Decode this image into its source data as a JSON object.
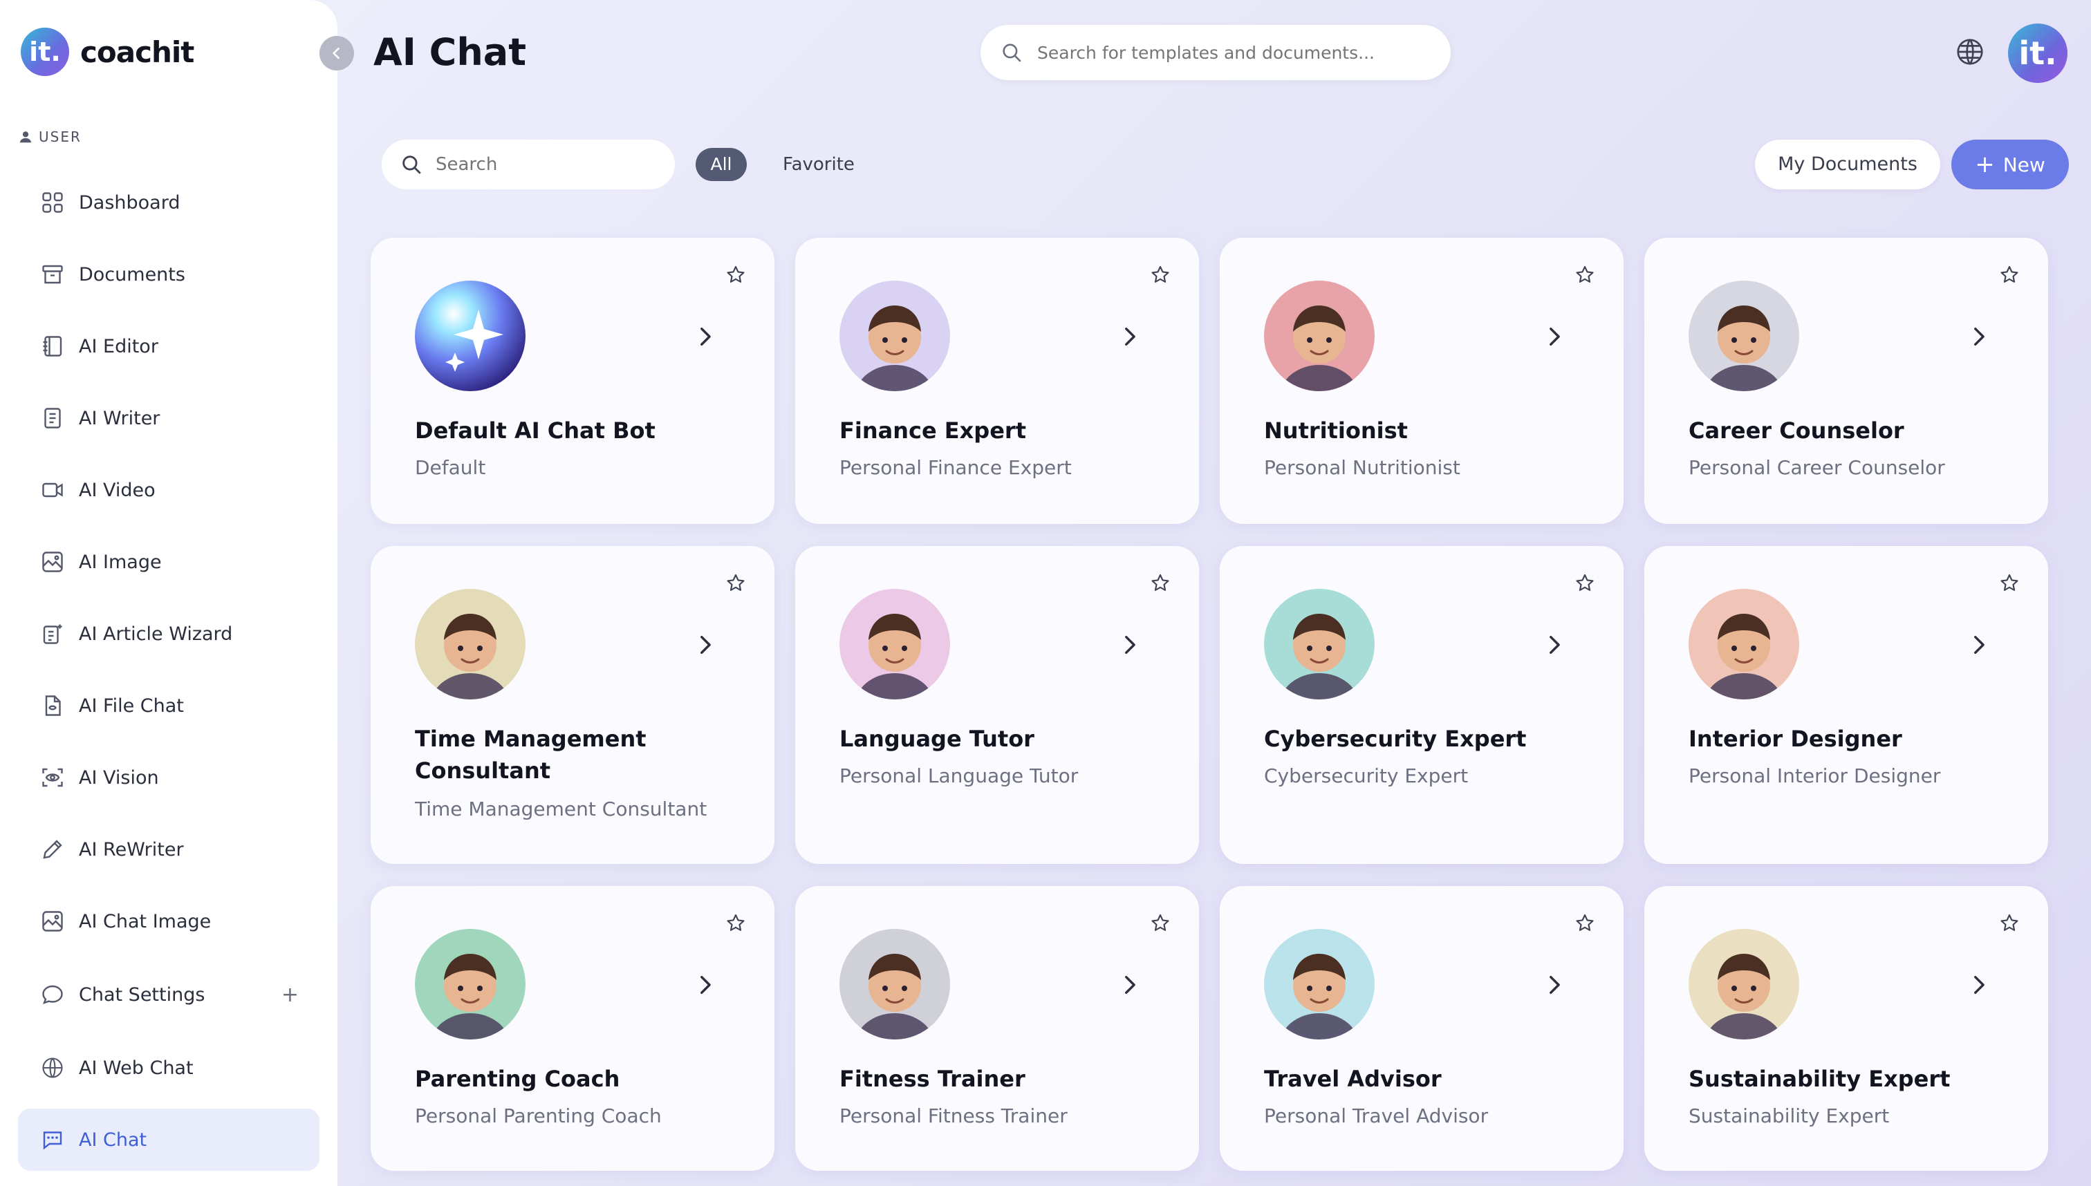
{
  "app": {
    "logo_mark": "it.",
    "logo_text": "coachit",
    "collapse_icon": "chevron-left-icon"
  },
  "sidebar": {
    "section_label": "USER",
    "items": [
      {
        "label": "Dashboard",
        "icon": "grid-icon"
      },
      {
        "label": "Documents",
        "icon": "archive-icon"
      },
      {
        "label": "AI Editor",
        "icon": "book-icon"
      },
      {
        "label": "AI Writer",
        "icon": "document-icon"
      },
      {
        "label": "AI Video",
        "icon": "video-icon"
      },
      {
        "label": "AI Image",
        "icon": "image-icon"
      },
      {
        "label": "AI Article Wizard",
        "icon": "wizard-icon"
      },
      {
        "label": "AI File Chat",
        "icon": "file-chat-icon"
      },
      {
        "label": "AI Vision",
        "icon": "eye-scan-icon"
      },
      {
        "label": "AI ReWriter",
        "icon": "pencil-icon"
      },
      {
        "label": "AI Chat Image",
        "icon": "image-icon"
      },
      {
        "label": "Chat Settings",
        "icon": "chat-bubble-icon",
        "expand": "+"
      },
      {
        "label": "AI Web Chat",
        "icon": "www-icon"
      },
      {
        "label": "AI Chat",
        "icon": "message-icon",
        "active": true
      }
    ]
  },
  "header": {
    "title": "AI Chat",
    "search_placeholder": "Search for templates and documents...",
    "avatar_text": "it."
  },
  "filters": {
    "search_placeholder": "Search",
    "tab_all": "All",
    "tab_favorite": "Favorite",
    "my_documents": "My Documents",
    "new_label": "New"
  },
  "colors": {
    "accent": "#6b7be8",
    "active_nav_bg": "#e8ecfb",
    "active_nav_text": "#3f5fd6",
    "pill_dark": "#545a74"
  },
  "cards": [
    {
      "title": "Default AI Chat Bot",
      "subtitle": "Default",
      "avatar_bg": "#7a8cf0"
    },
    {
      "title": "Finance Expert",
      "subtitle": "Personal Finance Expert",
      "avatar_bg": "#d9d2f2"
    },
    {
      "title": "Nutritionist",
      "subtitle": "Personal Nutritionist",
      "avatar_bg": "#e8a3a8"
    },
    {
      "title": "Career Counselor",
      "subtitle": "Personal Career Counselor",
      "avatar_bg": "#d6d7e0"
    },
    {
      "title": "Time Management Consultant",
      "subtitle": "Time Management Consultant",
      "avatar_bg": "#e4dcb8"
    },
    {
      "title": "Language Tutor",
      "subtitle": "Personal Language Tutor",
      "avatar_bg": "#ecc9e6"
    },
    {
      "title": "Cybersecurity Expert",
      "subtitle": "Cybersecurity Expert",
      "avatar_bg": "#a8dcd6"
    },
    {
      "title": "Interior Designer",
      "subtitle": "Personal Interior Designer",
      "avatar_bg": "#f0c4b6"
    },
    {
      "title": "Parenting Coach",
      "subtitle": "Personal Parenting Coach",
      "avatar_bg": "#9fd6bc"
    },
    {
      "title": "Fitness Trainer",
      "subtitle": "Personal Fitness Trainer",
      "avatar_bg": "#cfd0d8"
    },
    {
      "title": "Travel Advisor",
      "subtitle": "Personal Travel Advisor",
      "avatar_bg": "#b9e2ea"
    },
    {
      "title": "Sustainability Expert",
      "subtitle": "Sustainability Expert",
      "avatar_bg": "#eadfc0"
    }
  ]
}
